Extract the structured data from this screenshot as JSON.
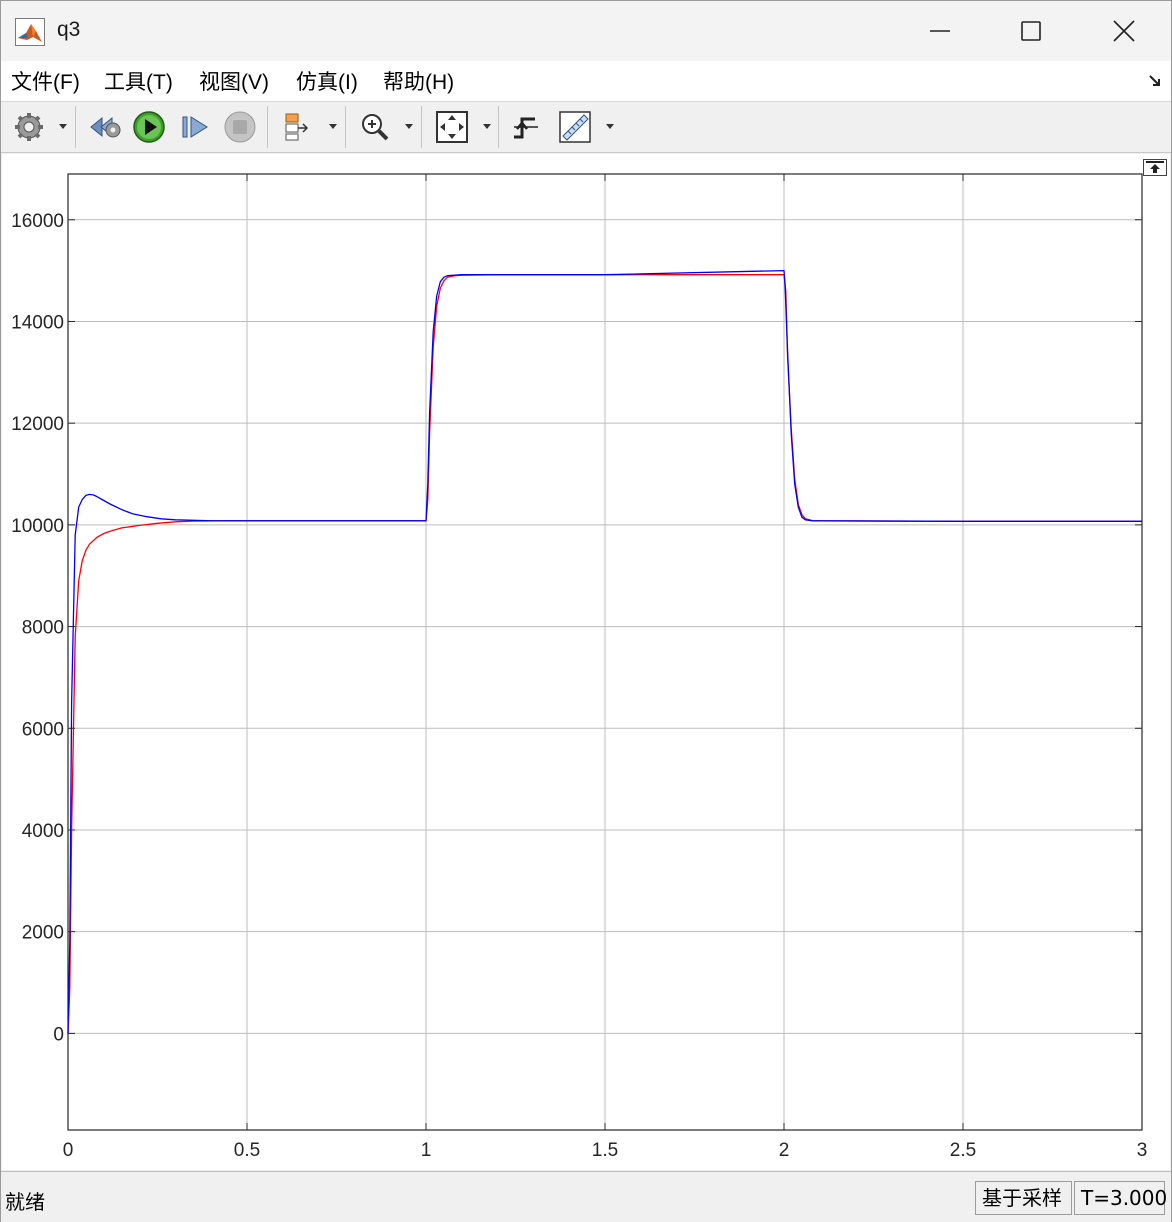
{
  "window": {
    "title": "q3"
  },
  "menu": {
    "items": [
      {
        "label": "文件(F)"
      },
      {
        "label": "工具(T)"
      },
      {
        "label": "视图(V)"
      },
      {
        "label": "仿真(I)"
      },
      {
        "label": "帮助(H)"
      }
    ]
  },
  "toolbar": {
    "icons": [
      "settings-gear-icon",
      "step-back-icon",
      "run-icon",
      "step-forward-icon",
      "stop-icon",
      "signal-select-icon",
      "zoom-in-icon",
      "fit-to-view-icon",
      "trigger-icon",
      "measurements-icon"
    ]
  },
  "status": {
    "text": "就绪",
    "sample_mode": "基于采样",
    "time": "T=3.000"
  },
  "colors": {
    "series_blue": "#0000ff",
    "series_red": "#ff0000",
    "grid": "#bdbdbd"
  },
  "chart_data": {
    "type": "line",
    "title": "",
    "xlabel": "",
    "ylabel": "",
    "xlim": [
      0,
      3
    ],
    "ylim": [
      -1900,
      16900
    ],
    "x_ticks": [
      "0",
      "0.5",
      "1",
      "1.5",
      "2",
      "2.5",
      "3"
    ],
    "y_ticks": [
      "0",
      "2000",
      "4000",
      "6000",
      "8000",
      "10000",
      "12000",
      "14000",
      "16000"
    ],
    "grid": true,
    "series": [
      {
        "color": "#0000ff",
        "x": [
          0,
          0.005,
          0.01,
          0.02,
          0.03,
          0.04,
          0.05,
          0.06,
          0.07,
          0.08,
          0.1,
          0.12,
          0.15,
          0.18,
          0.22,
          0.26,
          0.3,
          0.35,
          0.4,
          0.5,
          1.0,
          1.005,
          1.01,
          1.02,
          1.03,
          1.04,
          1.05,
          1.06,
          1.08,
          1.1,
          1.2,
          1.5,
          2.0,
          2.003,
          2.01,
          2.02,
          2.03,
          2.04,
          2.05,
          2.06,
          2.08,
          2.1,
          2.5,
          3.0
        ],
        "y": [
          0,
          1800,
          6500,
          9800,
          10350,
          10500,
          10580,
          10600,
          10590,
          10560,
          10480,
          10400,
          10300,
          10220,
          10160,
          10120,
          10100,
          10090,
          10080,
          10080,
          10080,
          10800,
          12200,
          13800,
          14500,
          14780,
          14870,
          14900,
          14910,
          14920,
          14920,
          14920,
          15000,
          14700,
          13400,
          11800,
          10800,
          10350,
          10150,
          10100,
          10080,
          10080,
          10070,
          10070
        ]
      },
      {
        "color": "#ff0000",
        "x": [
          0,
          0.005,
          0.01,
          0.02,
          0.03,
          0.04,
          0.05,
          0.06,
          0.08,
          0.1,
          0.12,
          0.15,
          0.2,
          0.25,
          0.3,
          0.35,
          0.4,
          0.5,
          1.0,
          1.005,
          1.01,
          1.02,
          1.03,
          1.04,
          1.05,
          1.06,
          1.08,
          1.1,
          1.2,
          1.5,
          2.0,
          2.005,
          2.01,
          2.02,
          2.03,
          2.04,
          2.05,
          2.06,
          2.08,
          2.1,
          2.5,
          3.0
        ],
        "y": [
          0,
          900,
          4000,
          7800,
          8900,
          9300,
          9500,
          9620,
          9750,
          9830,
          9880,
          9940,
          9990,
          10030,
          10060,
          10075,
          10080,
          10080,
          10080,
          10500,
          11800,
          13500,
          14300,
          14650,
          14800,
          14870,
          14900,
          14910,
          14920,
          14920,
          14920,
          14600,
          13300,
          11900,
          10900,
          10400,
          10200,
          10120,
          10085,
          10080,
          10070,
          10070
        ]
      }
    ]
  }
}
